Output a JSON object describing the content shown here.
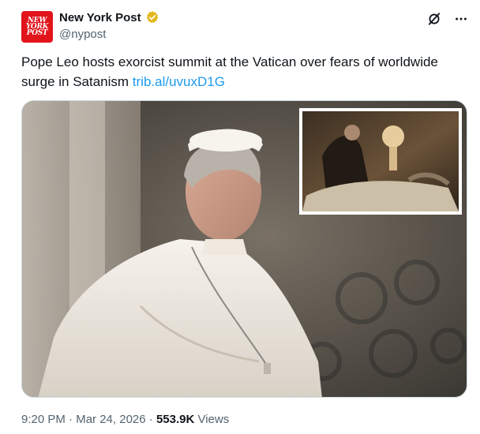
{
  "account": {
    "avatar_text": "NEW\nYORK\nPOST",
    "display_name": "New York Post",
    "handle": "@nypost",
    "verified": true,
    "verified_color": "#e2b719",
    "brand_color": "#e2141c"
  },
  "actions": {
    "grok_icon": "grok-icon",
    "more_icon": "more-icon"
  },
  "tweet": {
    "text": "Pope Leo hosts exorcist summit at the Vatican over fears of worldwide surge in Satanism ",
    "link_text": "trib.al/uvuxD1G",
    "link_color": "#1d9bf0"
  },
  "meta": {
    "time": "9:20 PM",
    "separator": " · ",
    "date": "Mar 24, 2026",
    "views_count": "553.9K",
    "views_label": " Views"
  }
}
